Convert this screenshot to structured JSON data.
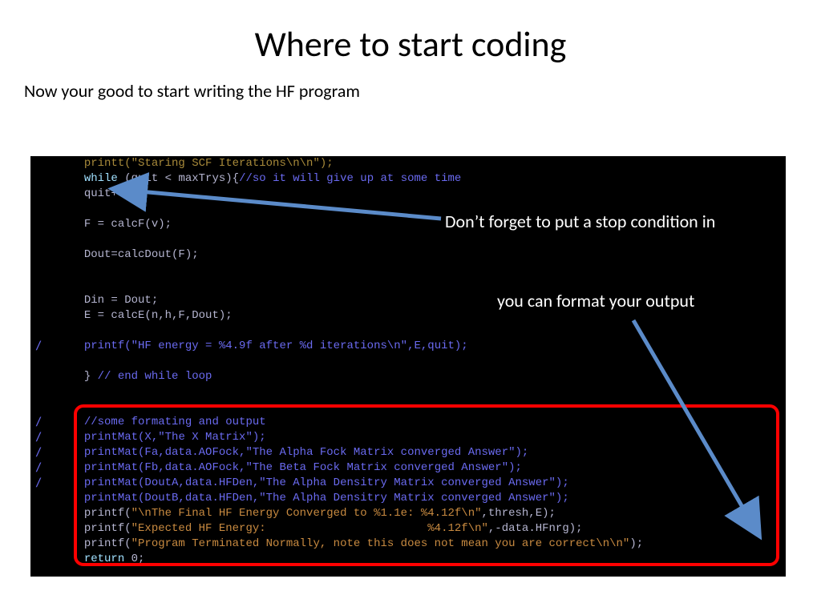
{
  "title": "Where to start coding",
  "subtitle": "Now your good to start writing the HF program",
  "annot1": "Don’t forget to put a stop condition in",
  "annot2": "you can format your output",
  "code": {
    "l0a": "printt(",
    "l0b": "\"Staring SCF Iterations\\n\\n\"",
    "l0c": ");",
    "l1a": "while ",
    "l1b": "(quit < maxTrys){",
    "l1c": "//so it will give up at some time",
    "l2": "quit++;",
    "l3": "F = calcF(v);",
    "l4": "Dout=calcDout(F);",
    "l5": "Din = Dout;",
    "l6": "E = calcE(n,h,F,Dout);",
    "l7a": "printf(",
    "l7b": "\"HF energy = %4.9f after %d iterations\\n\"",
    "l7c": ",E,quit);",
    "l8a": "} ",
    "l8b": "// end while loop",
    "l9": "//some formating and output",
    "l10a": "printMat(X,",
    "l10b": "\"The X Matrix\"",
    "l10c": ");",
    "l11a": "printMat(Fa,data.AOFock,",
    "l11b": "\"The Alpha Fock Matrix converged Answer\"",
    "l11c": ");",
    "l12a": "printMat(Fb,data.AOFock,",
    "l12b": "\"The Beta Fock Matrix converged Answer\"",
    "l12c": ");",
    "l13a": "printMat(DoutA,data.HFDen,",
    "l13b": "\"The Alpha Densitry Matrix converged Answer\"",
    "l13c": ");",
    "l14a": "printMat(DoutB,data.HFDen,",
    "l14b": "\"The Alpha Densitry Matrix converged Answer\"",
    "l14c": ");",
    "l15a": "printf(",
    "l15b": "\"\\nThe Final HF Energy Converged to %1.1e: %4.12f\\n\"",
    "l15c": ",thresh,E);",
    "l16a": "printf(",
    "l16b": "\"Expected HF Energy:                        %4.12f\\n\"",
    "l16c": ",-data.HFnrg);",
    "l17a": "printf(",
    "l17b": "\"Program Terminated Normally, note this does not mean you are correct\\n\\n\"",
    "l17c": ");",
    "l18a": "return ",
    "l18b": "0;"
  }
}
